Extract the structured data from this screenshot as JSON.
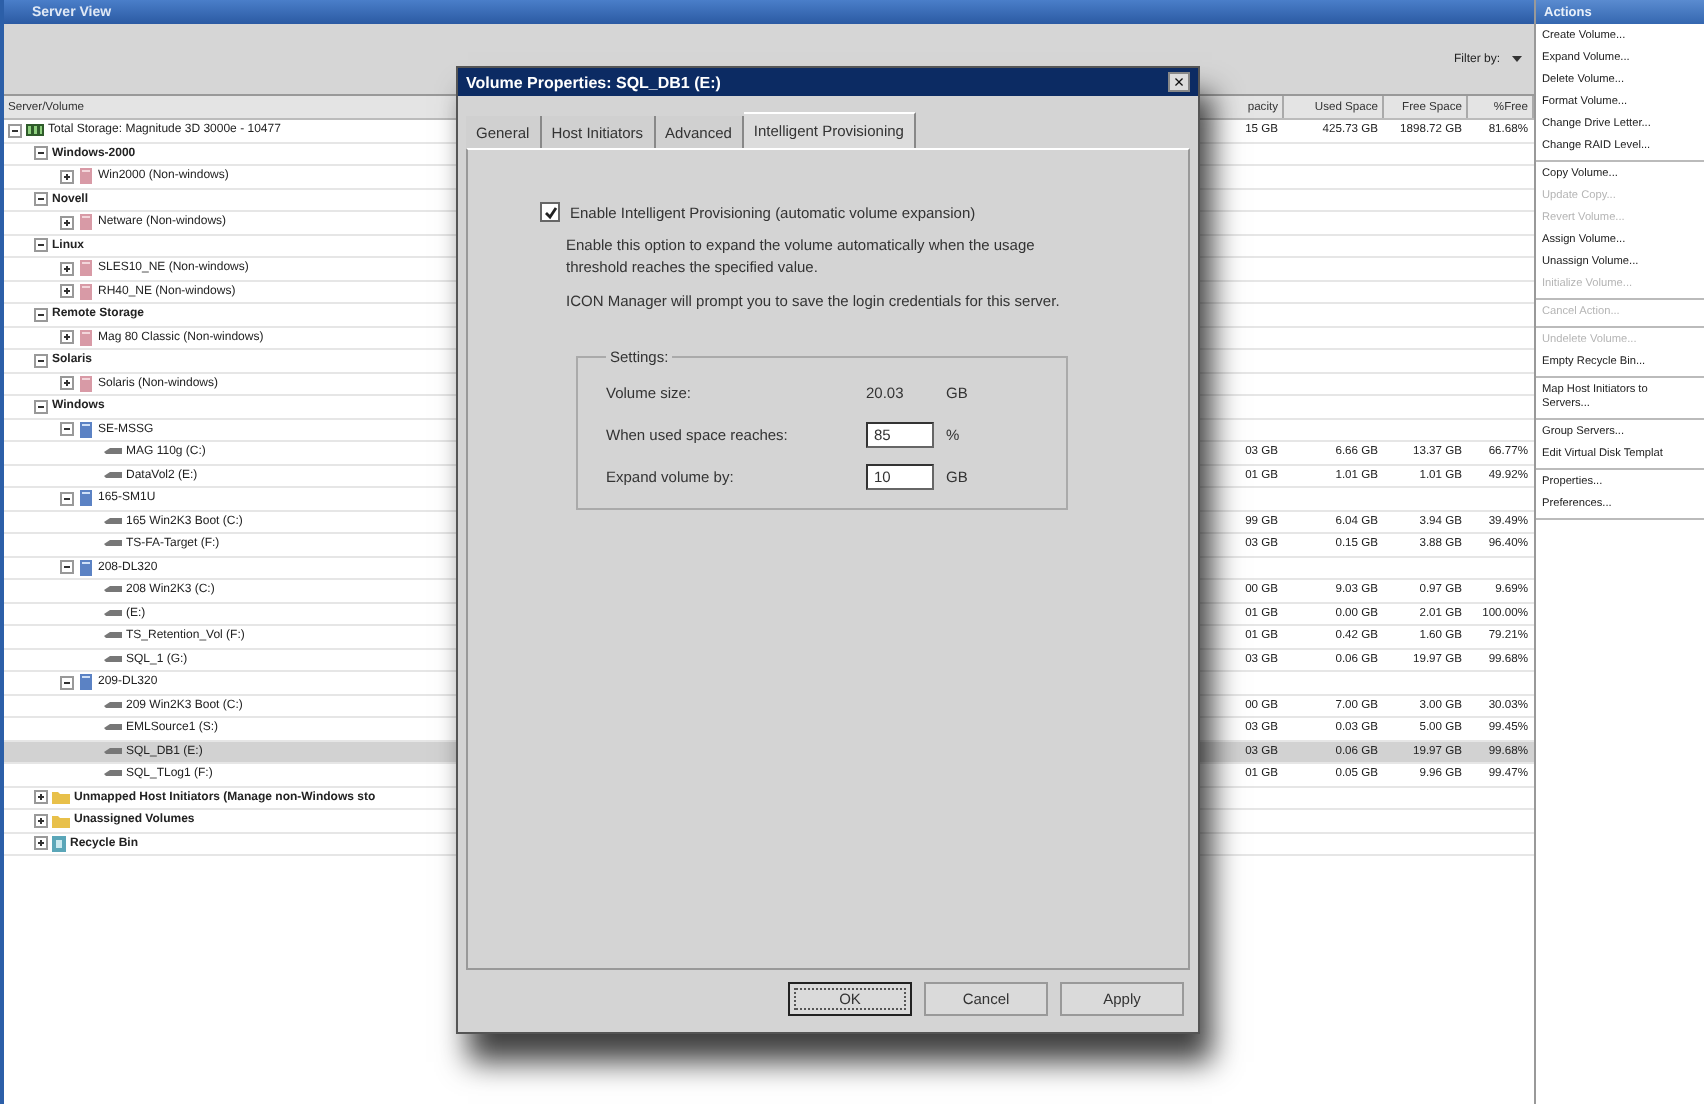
{
  "main_window": {
    "title": "Server View",
    "filter_label": "Filter by:"
  },
  "table": {
    "columns": [
      "Server/Volume",
      "pacity",
      "Used Space",
      "Free Space",
      "%Free"
    ],
    "tree": [
      {
        "label": "Total Storage: Magnitude 3D 3000e - 10477",
        "kind": "storage",
        "expanded": true,
        "selected": false,
        "values": [
          "15 GB",
          "425.73 GB",
          "1898.72 GB",
          "81.68%"
        ],
        "children": [
          {
            "label": "Windows-2000",
            "kind": "group",
            "expanded": true,
            "selected": false,
            "children": [
              {
                "label": "Win2000 (Non-windows)",
                "kind": "host",
                "expanded": false,
                "selected": false
              }
            ]
          },
          {
            "label": "Novell",
            "kind": "group",
            "expanded": true,
            "selected": false,
            "children": [
              {
                "label": "Netware (Non-windows)",
                "kind": "host",
                "expanded": false,
                "selected": false
              }
            ]
          },
          {
            "label": "Linux",
            "kind": "group",
            "expanded": true,
            "selected": false,
            "children": [
              {
                "label": "SLES10_NE (Non-windows)",
                "kind": "host",
                "expanded": false,
                "selected": false
              },
              {
                "label": "RH40_NE (Non-windows)",
                "kind": "host",
                "expanded": false,
                "selected": false
              }
            ]
          },
          {
            "label": "Remote Storage",
            "kind": "group",
            "expanded": true,
            "selected": false,
            "children": [
              {
                "label": "Mag 80 Classic (Non-windows)",
                "kind": "host",
                "expanded": false,
                "selected": false
              }
            ]
          },
          {
            "label": "Solaris",
            "kind": "group",
            "expanded": true,
            "selected": false,
            "children": [
              {
                "label": "Solaris (Non-windows)",
                "kind": "host",
                "expanded": false,
                "selected": false
              }
            ]
          },
          {
            "label": "Windows",
            "kind": "group",
            "expanded": true,
            "selected": false,
            "children": [
              {
                "label": "SE-MSSG",
                "kind": "server",
                "expanded": true,
                "selected": false,
                "children": [
                  {
                    "label": "MAG 110g (C:)",
                    "kind": "volume",
                    "selected": false,
                    "values": [
                      "03 GB",
                      "6.66 GB",
                      "13.37 GB",
                      "66.77%"
                    ]
                  },
                  {
                    "label": "DataVol2 (E:)",
                    "kind": "volume",
                    "selected": false,
                    "values": [
                      "01 GB",
                      "1.01 GB",
                      "1.01 GB",
                      "49.92%"
                    ]
                  }
                ]
              },
              {
                "label": "165-SM1U",
                "kind": "server",
                "expanded": true,
                "selected": false,
                "children": [
                  {
                    "label": "165 Win2K3 Boot (C:)",
                    "kind": "volume",
                    "selected": false,
                    "values": [
                      "99 GB",
                      "6.04 GB",
                      "3.94 GB",
                      "39.49%"
                    ]
                  },
                  {
                    "label": "TS-FA-Target (F:)",
                    "kind": "volume",
                    "selected": false,
                    "values": [
                      "03 GB",
                      "0.15 GB",
                      "3.88 GB",
                      "96.40%"
                    ]
                  }
                ]
              },
              {
                "label": "208-DL320",
                "kind": "server",
                "expanded": true,
                "selected": false,
                "children": [
                  {
                    "label": "208 Win2K3 (C:)",
                    "kind": "volume",
                    "selected": false,
                    "values": [
                      "00 GB",
                      "9.03 GB",
                      "0.97 GB",
                      "9.69%"
                    ]
                  },
                  {
                    "label": "(E:)",
                    "kind": "volume",
                    "selected": false,
                    "values": [
                      "01 GB",
                      "0.00 GB",
                      "2.01 GB",
                      "100.00%"
                    ]
                  },
                  {
                    "label": "TS_Retention_Vol (F:)",
                    "kind": "volume",
                    "selected": false,
                    "values": [
                      "01 GB",
                      "0.42 GB",
                      "1.60 GB",
                      "79.21%"
                    ]
                  },
                  {
                    "label": "SQL_1 (G:)",
                    "kind": "volume",
                    "selected": false,
                    "values": [
                      "03 GB",
                      "0.06 GB",
                      "19.97 GB",
                      "99.68%"
                    ]
                  }
                ]
              },
              {
                "label": "209-DL320",
                "kind": "server",
                "expanded": true,
                "selected": false,
                "children": [
                  {
                    "label": "209 Win2K3 Boot (C:)",
                    "kind": "volume",
                    "selected": false,
                    "values": [
                      "00 GB",
                      "7.00 GB",
                      "3.00 GB",
                      "30.03%"
                    ]
                  },
                  {
                    "label": "EMLSource1 (S:)",
                    "kind": "volume",
                    "selected": false,
                    "values": [
                      "03 GB",
                      "0.03 GB",
                      "5.00 GB",
                      "99.45%"
                    ]
                  },
                  {
                    "label": "SQL_DB1 (E:)",
                    "kind": "volume",
                    "selected": true,
                    "values": [
                      "03 GB",
                      "0.06 GB",
                      "19.97 GB",
                      "99.68%"
                    ]
                  },
                  {
                    "label": "SQL_TLog1 (F:)",
                    "kind": "volume",
                    "selected": false,
                    "values": [
                      "01 GB",
                      "0.05 GB",
                      "9.96 GB",
                      "99.47%"
                    ]
                  }
                ]
              }
            ]
          },
          {
            "label": "Unmapped Host Initiators (Manage non-Windows sto",
            "kind": "folder",
            "expanded": false,
            "selected": false
          },
          {
            "label": "Unassigned Volumes",
            "kind": "folder",
            "expanded": false,
            "selected": false
          },
          {
            "label": "Recycle Bin",
            "kind": "recycle",
            "expanded": false,
            "selected": false
          }
        ]
      }
    ]
  },
  "actions": {
    "title": "Actions",
    "groups": [
      [
        {
          "label": "Create Volume...",
          "disabled": false
        },
        {
          "label": "Expand Volume...",
          "disabled": false
        },
        {
          "label": "Delete Volume...",
          "disabled": false
        },
        {
          "label": "Format Volume...",
          "disabled": false
        },
        {
          "label": "Change Drive Letter...",
          "disabled": false
        },
        {
          "label": "Change RAID Level...",
          "disabled": false
        }
      ],
      [
        {
          "label": "Copy Volume...",
          "disabled": false
        },
        {
          "label": "Update Copy...",
          "disabled": true
        },
        {
          "label": "Revert Volume...",
          "disabled": true
        },
        {
          "label": "Assign Volume...",
          "disabled": false
        },
        {
          "label": "Unassign Volume...",
          "disabled": false
        },
        {
          "label": "Initialize Volume...",
          "disabled": true
        }
      ],
      [
        {
          "label": "Cancel Action...",
          "disabled": true
        }
      ],
      [
        {
          "label": "Undelete Volume...",
          "disabled": true
        },
        {
          "label": "Empty Recycle Bin...",
          "disabled": false
        }
      ],
      [
        {
          "label": "Map Host Initiators to Servers...",
          "disabled": false
        }
      ],
      [
        {
          "label": "Group Servers...",
          "disabled": false
        },
        {
          "label": "Edit Virtual Disk Templat",
          "disabled": false
        }
      ],
      [
        {
          "label": "Properties...",
          "disabled": false
        },
        {
          "label": "Preferences...",
          "disabled": false
        }
      ]
    ]
  },
  "dialog": {
    "title": "Volume Properties: SQL_DB1 (E:)",
    "close": "×",
    "tabs": [
      {
        "label": "General",
        "selected": false
      },
      {
        "label": "Host Initiators",
        "selected": false
      },
      {
        "label": "Advanced",
        "selected": false
      },
      {
        "label": "Intelligent Provisioning",
        "selected": true
      }
    ],
    "enable": {
      "label": "Enable Intelligent Provisioning (automatic volume expansion)",
      "checked": true
    },
    "paragraphs": [
      "Enable this option to expand the volume automatically when the usage threshold reaches the specified value.",
      "ICON Manager will prompt you to save the login credentials for this server."
    ],
    "settings": {
      "title": "Settings:",
      "rows": [
        {
          "kind": "value",
          "label": "Volume size:",
          "value": "20.03",
          "unit": "GB"
        },
        {
          "kind": "input",
          "label": "When used space reaches:",
          "value": "85",
          "unit": "%"
        },
        {
          "kind": "input",
          "label": "Expand volume by:",
          "value": "10",
          "unit": "GB"
        }
      ]
    },
    "buttons": [
      {
        "label": "OK",
        "default": true
      },
      {
        "label": "Cancel",
        "default": false
      },
      {
        "label": "Apply",
        "default": false
      }
    ]
  }
}
